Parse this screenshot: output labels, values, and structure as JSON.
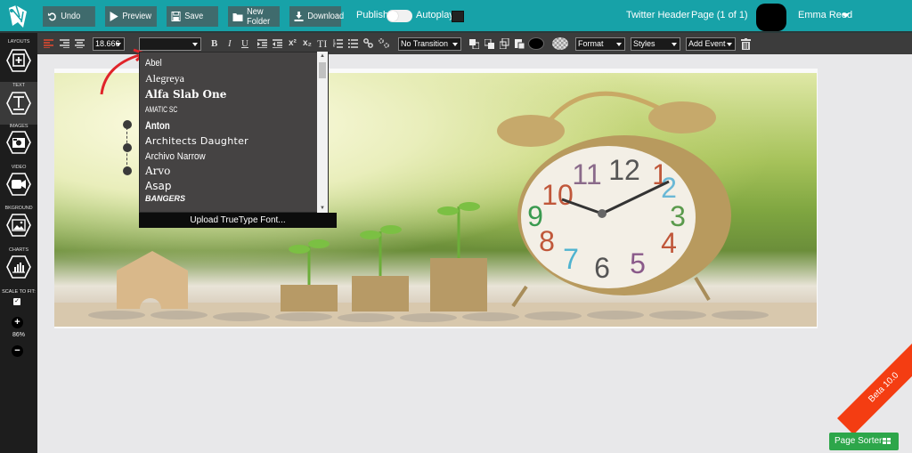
{
  "topbar": {
    "buttons": [
      {
        "label": "Undo",
        "icon": "undo-icon"
      },
      {
        "label": "Preview",
        "icon": "play-icon"
      },
      {
        "label": "Save",
        "icon": "floppy-icon"
      },
      {
        "label": "New Folder",
        "icon": "folder-icon"
      },
      {
        "label": "Download",
        "icon": "download-icon"
      }
    ],
    "publish_label": "Publish:",
    "publish_on": false,
    "autoplay_label": "Autoplay:",
    "project_name": "Twitter Header",
    "page_indicator": "Page (1 of 1)",
    "user_name": "Emma Reed",
    "accent_color": "#17a2a8"
  },
  "sidebar": {
    "items": [
      {
        "label": "LAYOUTS",
        "icon": "plus-square-icon"
      },
      {
        "label": "TEXT",
        "icon": "text-icon",
        "active": true
      },
      {
        "label": "IMAGES",
        "icon": "camera-icon"
      },
      {
        "label": "VIDEO",
        "icon": "video-camera-icon"
      },
      {
        "label": "BKGROUND",
        "icon": "picture-icon"
      },
      {
        "label": "CHARTS",
        "icon": "bar-chart-icon"
      }
    ],
    "scale_label": "SCALE TO FIT:",
    "scale_checked": true,
    "zoom_in": "+",
    "zoom_value": "86%",
    "zoom_out": "−"
  },
  "toolbar": {
    "font_size": "18.666",
    "font_family": "",
    "bold": "B",
    "italic": "I",
    "underline": "U",
    "superscript": "x²",
    "subscript": "x₂",
    "transition": "No Transition",
    "format": "Format",
    "styles": "Styles",
    "add_event": "Add Event"
  },
  "font_dropdown": {
    "fonts": [
      "Abel",
      "Alegreya",
      "Alfa Slab One",
      "AMATIC SC",
      "Anton",
      "Architects Daughter",
      "Archivo Narrow",
      "Arvo",
      "Asap",
      "BANGERS"
    ],
    "upload_label": "Upload TrueType Font..."
  },
  "footer": {
    "page_sorter": "Page Sorter",
    "ribbon": "Beta 10.0"
  }
}
